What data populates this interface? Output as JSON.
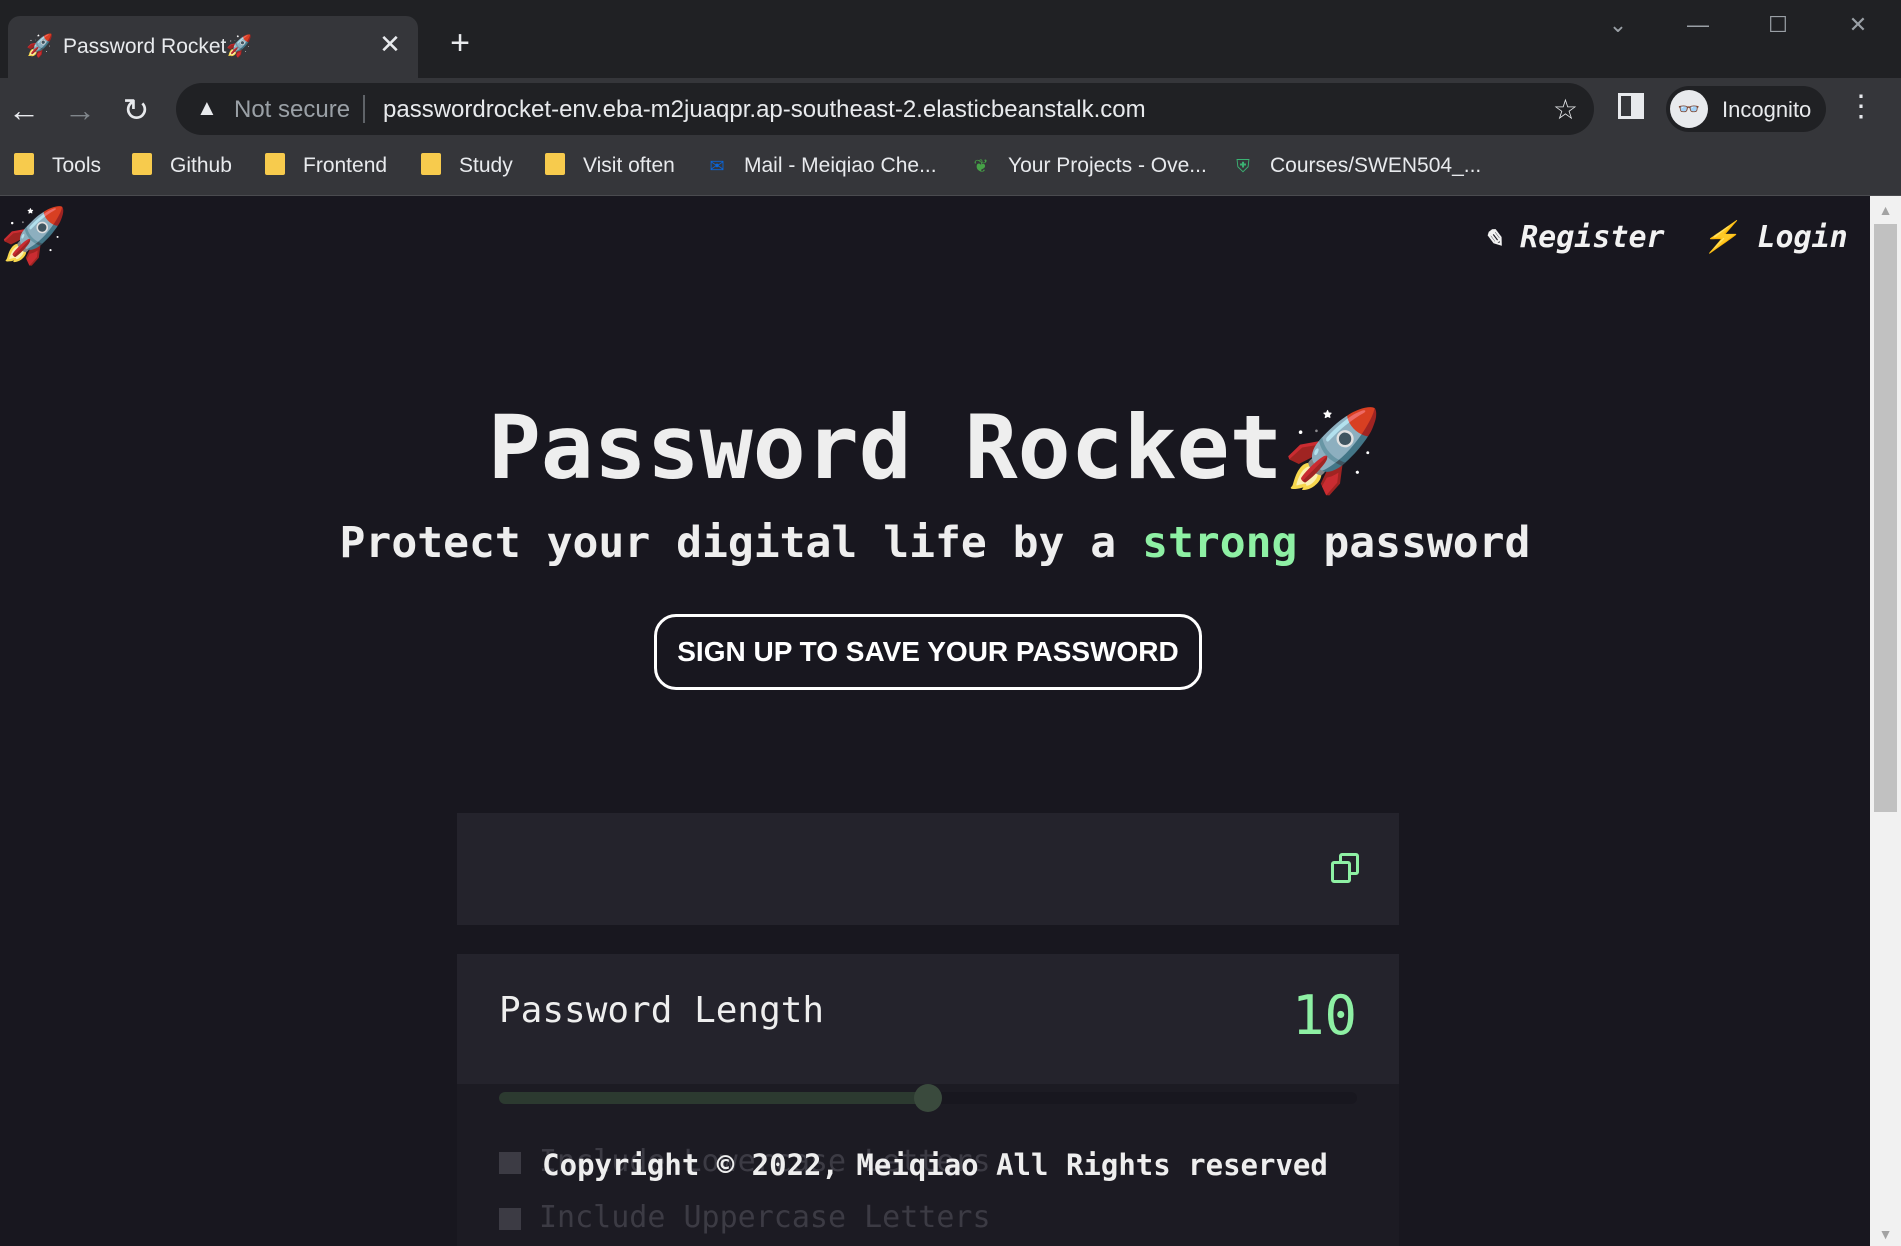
{
  "browser": {
    "tab": {
      "favicon": "🚀",
      "title": "Password Rocket🚀",
      "close": "✕"
    },
    "new_tab": "+",
    "window_controls": {
      "tab_search": "⌄",
      "minimize": "—",
      "maximize": "☐",
      "close": "✕"
    },
    "nav": {
      "back": "←",
      "forward": "→",
      "reload": "↻"
    },
    "omnibox": {
      "warning_icon": "▲",
      "security_label": "Not secure",
      "url": "passwordrocket-env.eba-m2juaqpr.ap-southeast-2.elasticbeanstalk.com",
      "star": "☆"
    },
    "profile": {
      "avatar": "👓",
      "label": "Incognito"
    },
    "menu": "⋮",
    "bookmarks": [
      {
        "label": "Tools",
        "icon": "folder"
      },
      {
        "label": "Github",
        "icon": "folder"
      },
      {
        "label": "Frontend",
        "icon": "folder"
      },
      {
        "label": "Study",
        "icon": "folder"
      },
      {
        "label": "Visit often",
        "icon": "folder"
      },
      {
        "label": "Mail - Meiqiao Che...",
        "icon": "outlook-icon",
        "glyph": "✉"
      },
      {
        "label": "Your Projects - Ove...",
        "icon": "overleaf-icon",
        "glyph": "❦"
      },
      {
        "label": "Courses/SWEN504_...",
        "icon": "university-icon",
        "glyph": "⛨"
      }
    ]
  },
  "site": {
    "logo": "🚀",
    "nav": {
      "register": "Register",
      "register_icon": "✎",
      "login": "Login",
      "login_icon": "⚡"
    },
    "hero": {
      "title": "Password Rocket",
      "title_emoji": "🚀",
      "subtitle_before": "Protect your digital life by a ",
      "subtitle_accent": "strong",
      "subtitle_after": " password",
      "cta": "SIGN UP TO SAVE YOUR PASSWORD"
    },
    "generator": {
      "password": "",
      "length_label": "Password Length",
      "length_value": "10",
      "slider_level": 0.5,
      "options": [
        "Include Lowercase Letters",
        "Include Uppercase Letters"
      ]
    },
    "footer": "Copyright © 2022, Meiqiao All Rights reserved"
  },
  "colors": {
    "accent": "#8ef0a4",
    "page_bg": "#18171f",
    "panel_bg": "#24232c"
  }
}
